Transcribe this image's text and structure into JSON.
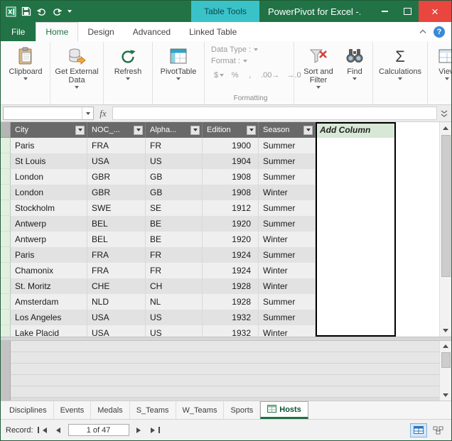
{
  "colors": {
    "title_green": "#217346",
    "contextual_teal": "#3ac2c9",
    "close_red": "#e8463f",
    "grid_header_gray": "#696969",
    "add_column_header_green": "#d8e8d6",
    "active_sheet_underline": "#1e7145"
  },
  "titlebar": {
    "contextual_label": "Table Tools",
    "title": "PowerPivot for Excel -..."
  },
  "tabs": {
    "file": "File",
    "items": [
      "Home",
      "Design",
      "Advanced",
      "Linked Table"
    ],
    "active": "Home"
  },
  "ribbon": {
    "clipboard_label": "Clipboard",
    "get_external_data_label": "Get External Data",
    "refresh_label": "Refresh",
    "pivottable_label": "PivotTable",
    "data_type_label": "Data Type :",
    "format_label": "Format :",
    "currency_label": "$",
    "percent_label": "%",
    "thousands_label": ",",
    "increase_decimal_label": ".00→",
    "decrease_decimal_label": "→.0",
    "formatting_group_label": "Formatting",
    "sort_filter_label": "Sort and Filter",
    "find_label": "Find",
    "calculations_label": "Calculations",
    "view_label": "View"
  },
  "formula_bar": {
    "fx_label": "fx"
  },
  "table": {
    "columns": [
      "City",
      "NOC_...",
      "Alpha...",
      "Edition",
      "Season"
    ],
    "add_column_label": "Add Column",
    "rows": [
      [
        "Paris",
        "FRA",
        "FR",
        "1900",
        "Summer"
      ],
      [
        "St Louis",
        "USA",
        "US",
        "1904",
        "Summer"
      ],
      [
        "London",
        "GBR",
        "GB",
        "1908",
        "Summer"
      ],
      [
        "London",
        "GBR",
        "GB",
        "1908",
        "Winter"
      ],
      [
        "Stockholm",
        "SWE",
        "SE",
        "1912",
        "Summer"
      ],
      [
        "Antwerp",
        "BEL",
        "BE",
        "1920",
        "Summer"
      ],
      [
        "Antwerp",
        "BEL",
        "BE",
        "1920",
        "Winter"
      ],
      [
        "Paris",
        "FRA",
        "FR",
        "1924",
        "Summer"
      ],
      [
        "Chamonix",
        "FRA",
        "FR",
        "1924",
        "Winter"
      ],
      [
        "St. Moritz",
        "CHE",
        "CH",
        "1928",
        "Winter"
      ],
      [
        "Amsterdam",
        "NLD",
        "NL",
        "1928",
        "Summer"
      ],
      [
        "Los Angeles",
        "USA",
        "US",
        "1932",
        "Summer"
      ],
      [
        "Lake Placid",
        "USA",
        "US",
        "1932",
        "Winter"
      ]
    ]
  },
  "sheet_tabs": {
    "items": [
      "Disciplines",
      "Events",
      "Medals",
      "S_Teams",
      "W_Teams",
      "Sports",
      "Hosts"
    ],
    "active": "Hosts"
  },
  "status_bar": {
    "record_label": "Record:",
    "record_value": "1 of 47"
  }
}
